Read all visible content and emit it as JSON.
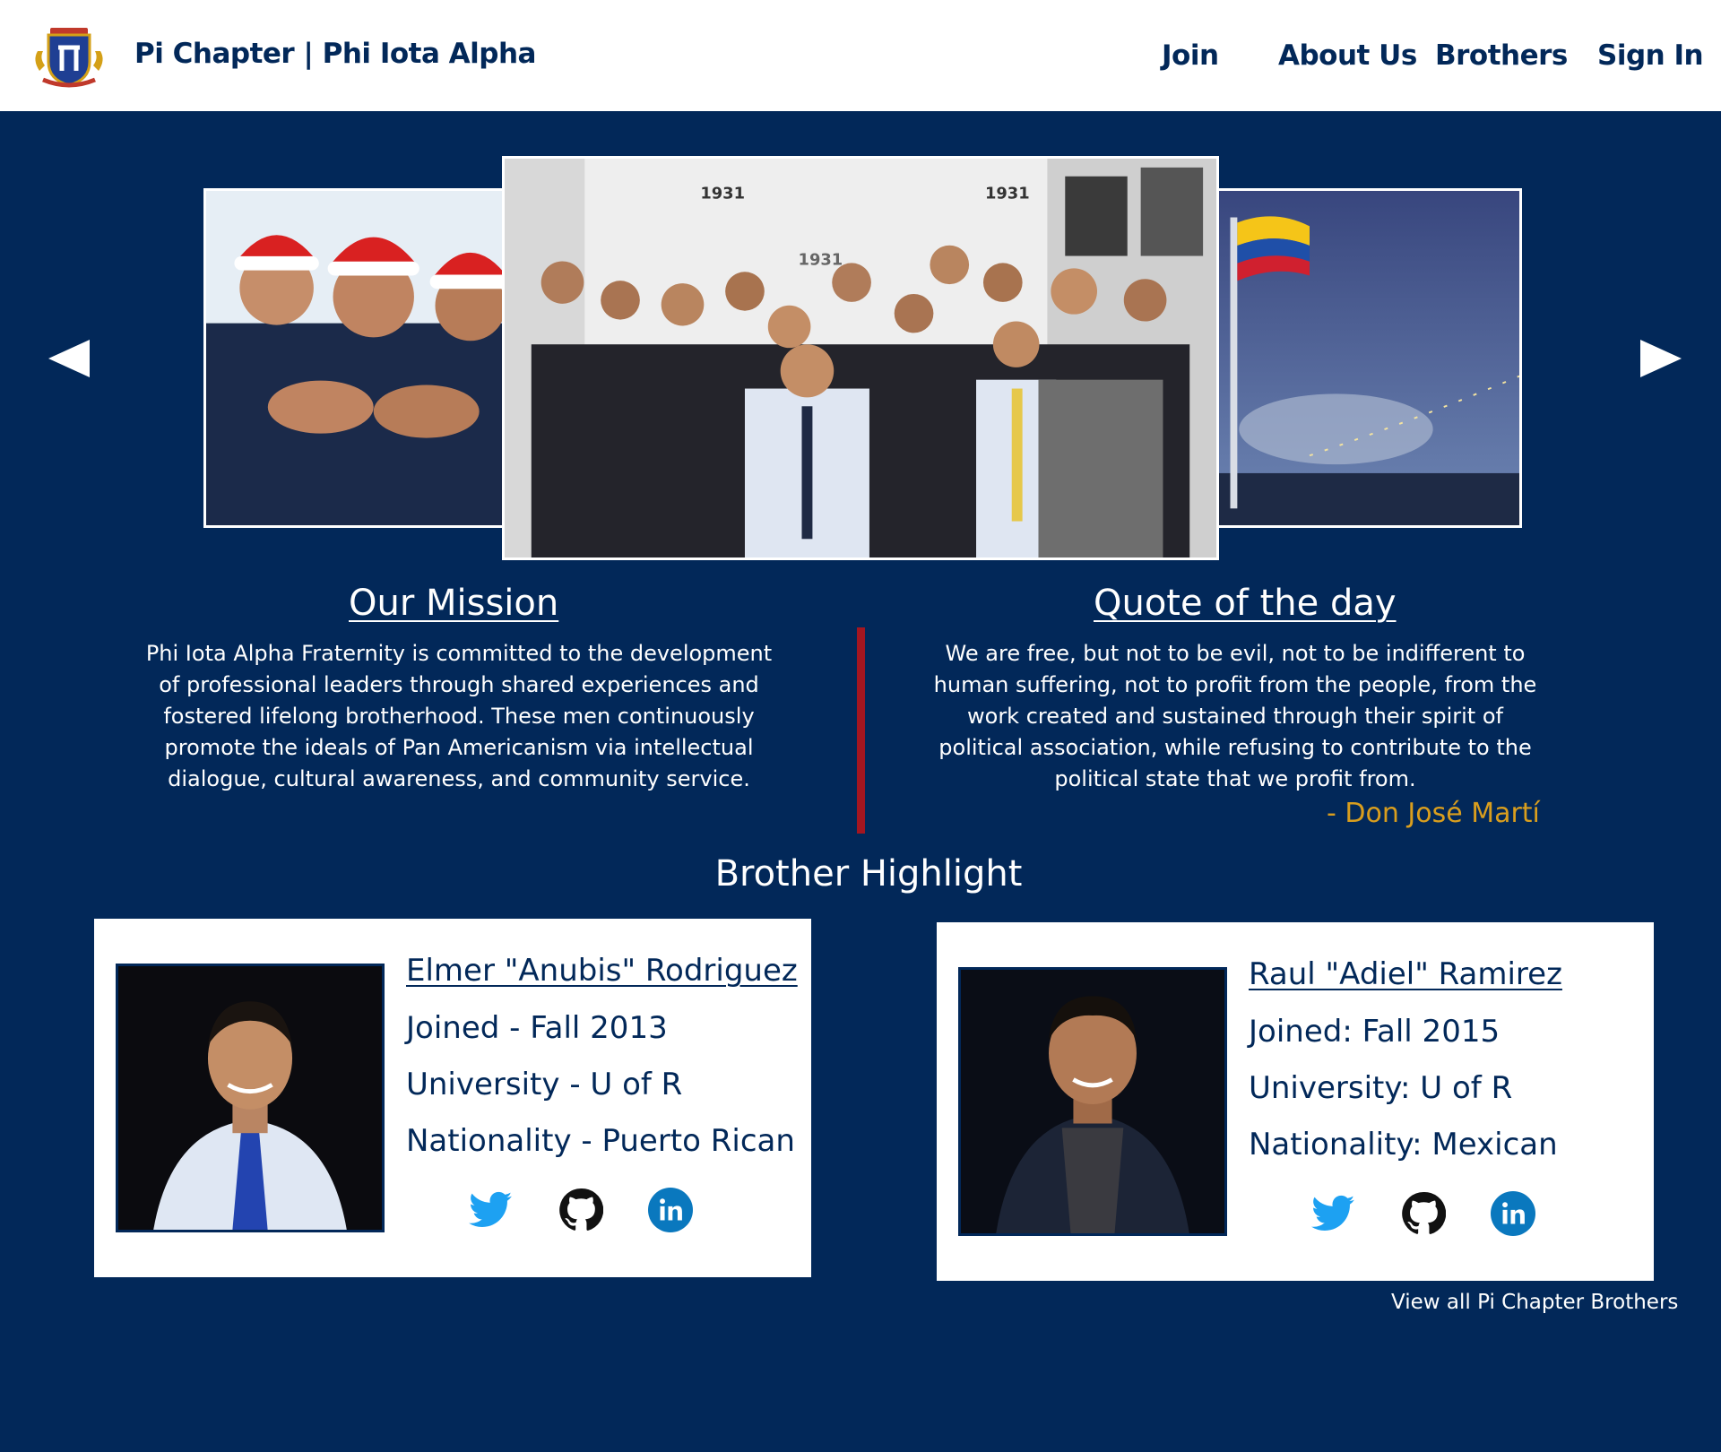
{
  "header": {
    "brand": "Pi Chapter | Phi Iota Alpha",
    "nav": {
      "join": "Join",
      "about": "About Us",
      "brothers": "Brothers",
      "signin": "Sign In"
    }
  },
  "carousel": {
    "prev_icon": "triangle-left-icon",
    "next_icon": "triangle-right-icon",
    "center_banner_text": "1931"
  },
  "mission": {
    "heading": "Our Mission",
    "text": "Phi Iota Alpha Fraternity is committed to the development of professional leaders through shared experiences and fostered lifelong brotherhood. These men continuously promote the ideals of Pan Americanism via intellectual dialogue, cultural awareness, and community service."
  },
  "quote": {
    "heading": "Quote of the day",
    "text": "We are free, but not to be evil, not to be indifferent to human suffering, not to profit from the people, from the work created and sustained through their spirit of political association, while refusing to contribute to the political state that we profit from.",
    "author": "- Don José Martí"
  },
  "highlight": {
    "heading": "Brother Highlight",
    "brothers": [
      {
        "name": "Elmer \"Anubis\" Rodriguez",
        "joined": "Joined - Fall 2013",
        "university": "University - U of R",
        "nationality": "Nationality - Puerto Rican"
      },
      {
        "name": "Raul \"Adiel\" Ramirez ",
        "joined": "Joined: Fall 2015",
        "university": "University: U of R",
        "nationality": "Nationality: Mexican"
      }
    ],
    "view_all": "View all Pi Chapter Brothers"
  },
  "colors": {
    "navy": "#022859",
    "divider_red": "#a31621",
    "author_gold": "#d99e1e",
    "twitter_blue": "#1da1f2",
    "linkedin_blue": "#0a78be"
  }
}
